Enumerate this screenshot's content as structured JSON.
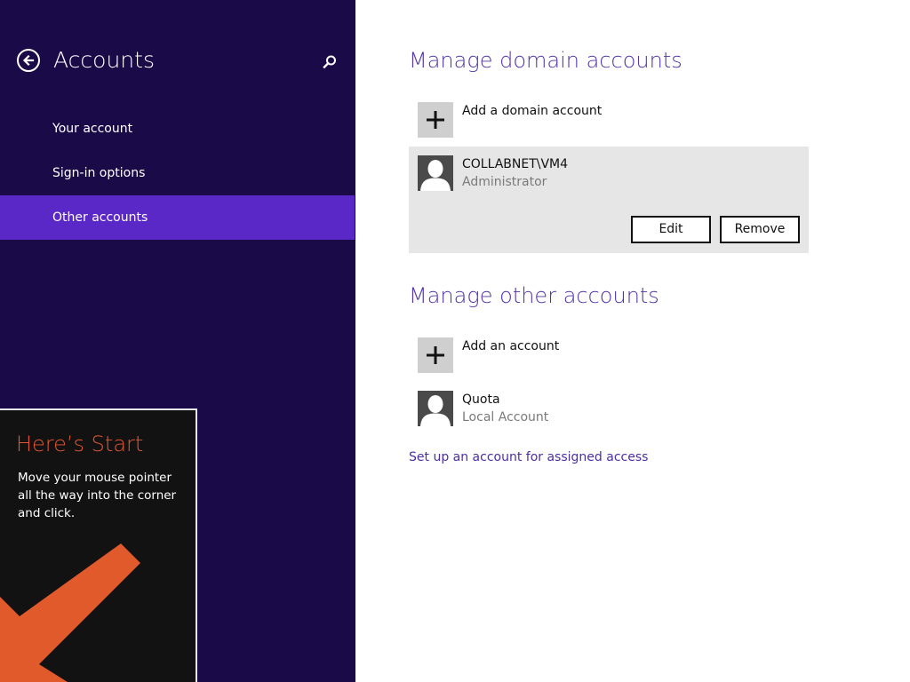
{
  "colors": {
    "nav_background": "#1b0a48",
    "nav_selected": "#5b28c8",
    "accent_title": "#5233a8",
    "tip_title": "#e25732",
    "tip_arrow": "#e05a2b"
  },
  "nav": {
    "back_icon": "back-arrow-icon",
    "title": "Accounts",
    "search_icon": "search-icon",
    "items": [
      {
        "label": "Your account",
        "selected": false
      },
      {
        "label": "Sign-in options",
        "selected": false
      },
      {
        "label": "Other accounts",
        "selected": true
      }
    ]
  },
  "tip": {
    "title": "Here’s Start",
    "body": "Move your mouse pointer all the way into the corner and click.",
    "arrow_icon": "arrow-down-left-icon"
  },
  "domain_section": {
    "title": "Manage domain accounts",
    "add_label": "Add a domain account",
    "add_icon": "plus-icon",
    "account": {
      "name": "COLLABNET\\VM4",
      "role": "Administrator",
      "avatar_icon": "user-avatar-icon",
      "edit_label": "Edit",
      "remove_label": "Remove"
    }
  },
  "other_section": {
    "title": "Manage other accounts",
    "add_label": "Add an account",
    "add_icon": "plus-icon",
    "account": {
      "name": "Quota",
      "type": "Local Account",
      "avatar_icon": "user-avatar-icon"
    }
  },
  "assigned_access_link": "Set up an account for assigned access"
}
